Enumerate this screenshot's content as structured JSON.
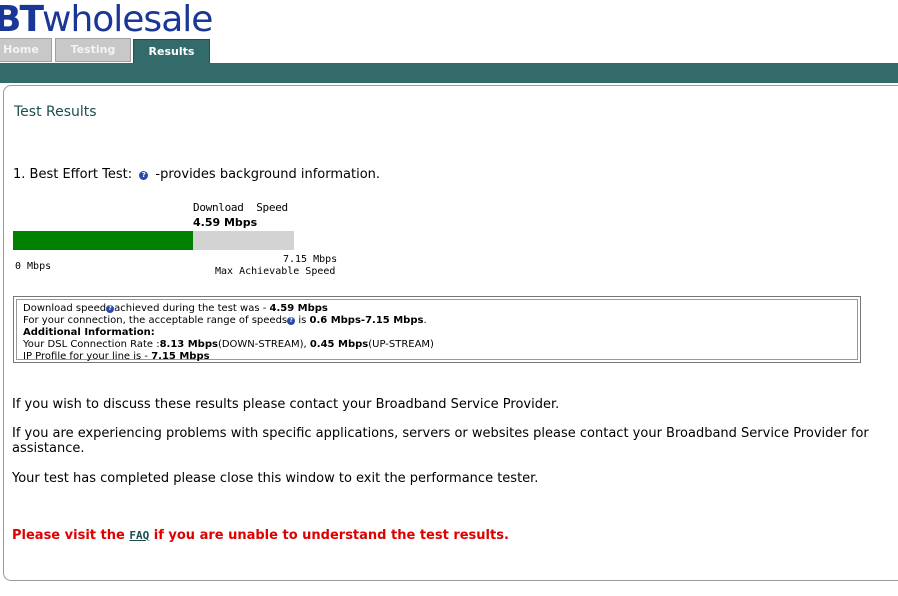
{
  "brand": {
    "bt": "BT",
    "wholesale": "wholesale"
  },
  "tabs": [
    {
      "label": "Home"
    },
    {
      "label": "Testing"
    },
    {
      "label": "Results",
      "active": true
    }
  ],
  "colors": {
    "accent": "#336b6b",
    "brand_blue": "#1a3696",
    "meter_fill": "#008000",
    "meter_track": "#d3d3d3",
    "warning": "#e00000"
  },
  "page": {
    "title": "Test Results"
  },
  "best_effort": {
    "prefix": "1. Best Effort Test:",
    "help_icon": "question-icon",
    "suffix": "-provides background information."
  },
  "meter": {
    "download_label": "Download  Speed",
    "download_value": "4.59 Mbps",
    "fill_fraction": 0.642,
    "min_label": "0 Mbps",
    "max_label": "7.15 Mbps",
    "max_caption": "Max Achievable Speed"
  },
  "info": {
    "l1a": "Download speed",
    "l1b": "achieved during the test was - ",
    "l1c": "4.59 Mbps",
    "l2a": "For your connection, the acceptable range of speeds",
    "l2b": " is ",
    "l2c": "0.6 Mbps-7.15 Mbps",
    "l2d": ".",
    "l3": "Additional Information:",
    "l4a": "Your DSL Connection Rate :",
    "l4b": "8.13 Mbps",
    "l4c": "(DOWN-STREAM), ",
    "l4d": "0.45 Mbps",
    "l4e": "(UP-STREAM)",
    "l5a": "IP Profile for your line is - ",
    "l5b": "7.15 Mbps"
  },
  "paragraphs": [
    "If you wish to discuss these results please contact your Broadband Service Provider.",
    "If you are experiencing problems with specific applications, servers or websites please contact your Broadband Service Provider for assistance.",
    "Your test has completed please close this window to exit the performance tester."
  ],
  "warning": {
    "before": "Please visit the ",
    "link": "FAQ",
    "after": " if you are unable to understand the test results."
  }
}
